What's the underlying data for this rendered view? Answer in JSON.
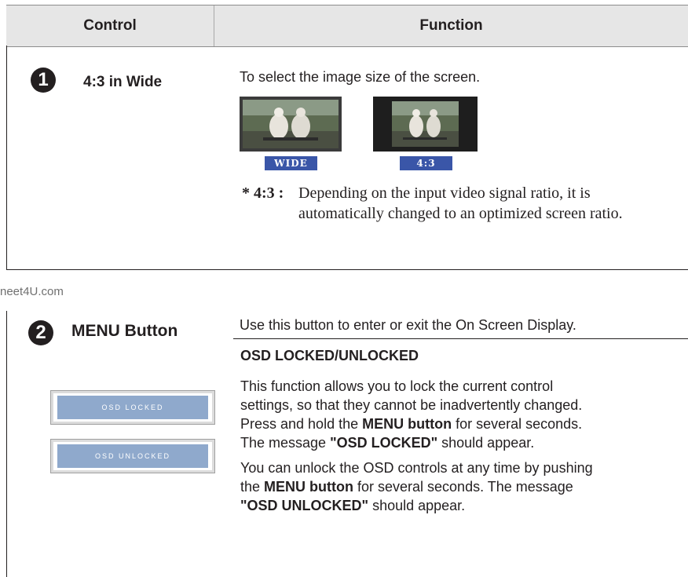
{
  "header": {
    "control": "Control",
    "function": "Function"
  },
  "item1": {
    "number": "1",
    "name": "4:3 in Wide",
    "description": "To select the image size of the screen.",
    "modes": [
      "WIDE",
      "4:3"
    ],
    "note_key": "* 4:3 :",
    "note_text_1": "Depending on the input video signal ratio, it is",
    "note_text_2": "automatically changed to an optimized screen ratio."
  },
  "watermark": "neet4U.com",
  "item2": {
    "number": "2",
    "name": "MENU Button",
    "description": "Use this button to enter or exit the On Screen Display.",
    "subheading": "OSD LOCKED/UNLOCKED",
    "osd_locked": "OSD LOCKED",
    "osd_unlocked": "OSD UNLOCKED",
    "p1_line1": "This function allows you to lock the current control",
    "p1_line2": "settings, so that they cannot be inadvertently changed.",
    "p1_line3_a": "Press and hold the ",
    "p1_line3_b": "MENU button",
    "p1_line3_c": " for several seconds.",
    "p1_line4_a": "The message ",
    "p1_line4_b": "\"OSD LOCKED\"",
    "p1_line4_c": " should appear.",
    "p2_line1": "You can unlock the OSD controls at any time by pushing",
    "p2_line2_a": "the ",
    "p2_line2_b": "MENU button",
    "p2_line2_c": " for several seconds. The message",
    "p2_line3_a": "\"OSD UNLOCKED\"",
    "p2_line3_b": " should appear."
  }
}
